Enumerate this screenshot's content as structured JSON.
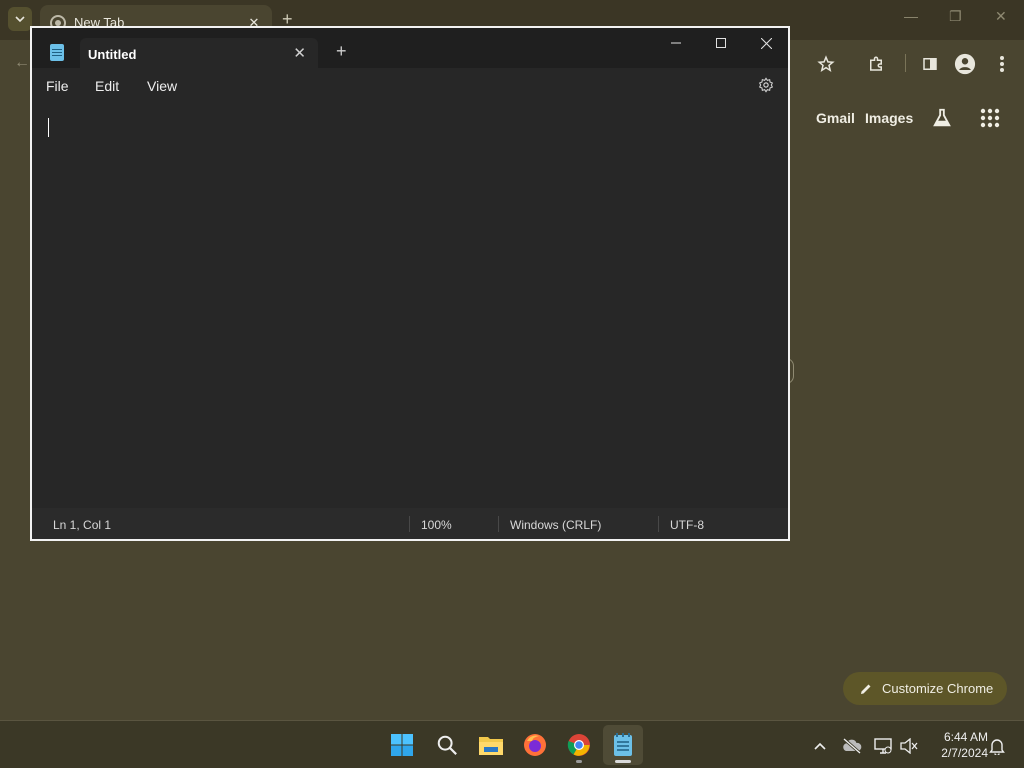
{
  "chrome": {
    "tab_title": "New Tab",
    "header_links": [
      "Gmail",
      "Images"
    ],
    "customize_label": "Customize Chrome"
  },
  "notepad": {
    "tab_title": "Untitled",
    "menu": [
      "File",
      "Edit",
      "View"
    ],
    "status": {
      "position": "Ln 1, Col 1",
      "zoom": "100%",
      "line_ending": "Windows (CRLF)",
      "encoding": "UTF-8"
    }
  },
  "taskbar": {
    "apps": [
      "start-icon",
      "search-icon",
      "file-explorer-icon",
      "firefox-icon",
      "chrome-icon",
      "notepad-icon"
    ],
    "clock_time": "6:44 AM",
    "clock_date": "2/7/2024"
  },
  "colors": {
    "desktop_bg": "#4a4530",
    "notepad_bg": "#272727",
    "accent": "#6cc0e8"
  }
}
